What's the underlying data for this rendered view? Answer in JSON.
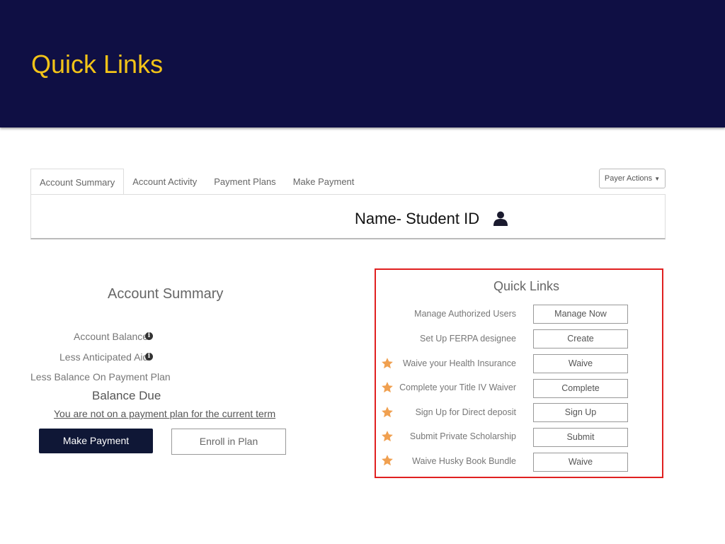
{
  "slide": {
    "title": "Quick Links"
  },
  "tabs": [
    {
      "label": "Account Summary",
      "active": true
    },
    {
      "label": "Account Activity",
      "active": false
    },
    {
      "label": "Payment Plans",
      "active": false
    },
    {
      "label": "Make Payment",
      "active": false
    }
  ],
  "payer_actions": {
    "label": "Payer Actions"
  },
  "header": {
    "student": "Name- Student ID",
    "icon": "person-icon"
  },
  "account_summary": {
    "title": "Account Summary",
    "rows": [
      {
        "label": "Account Balance",
        "info": true
      },
      {
        "label": "Less Anticipated Aid",
        "info": true
      },
      {
        "label": "Less Balance On Payment Plan",
        "info": false
      }
    ],
    "balance_due": "Balance Due",
    "plan_link": "You are not on a payment plan for the current term",
    "make_payment": "Make Payment",
    "enroll": "Enroll in Plan"
  },
  "quick_links": {
    "title": "Quick Links",
    "items": [
      {
        "label": "Manage Authorized Users",
        "button": "Manage Now",
        "starred": false
      },
      {
        "label": "Set Up FERPA designee",
        "button": "Create",
        "starred": false
      },
      {
        "label": "Waive your Health Insurance",
        "button": "Waive",
        "starred": true
      },
      {
        "label": "Complete your Title IV Waiver",
        "button": "Complete",
        "starred": true
      },
      {
        "label": "Sign Up for Direct deposit",
        "button": "Sign Up",
        "starred": true
      },
      {
        "label": "Submit Private Scholarship",
        "button": "Submit",
        "starred": true
      },
      {
        "label": "Waive Husky Book Bundle",
        "button": "Waive",
        "starred": true
      }
    ]
  },
  "colors": {
    "banner": "#0f0f44",
    "title": "#f2c318",
    "highlight_border": "#e02020",
    "star": "#f0a050",
    "primary_button": "#0f1736"
  }
}
